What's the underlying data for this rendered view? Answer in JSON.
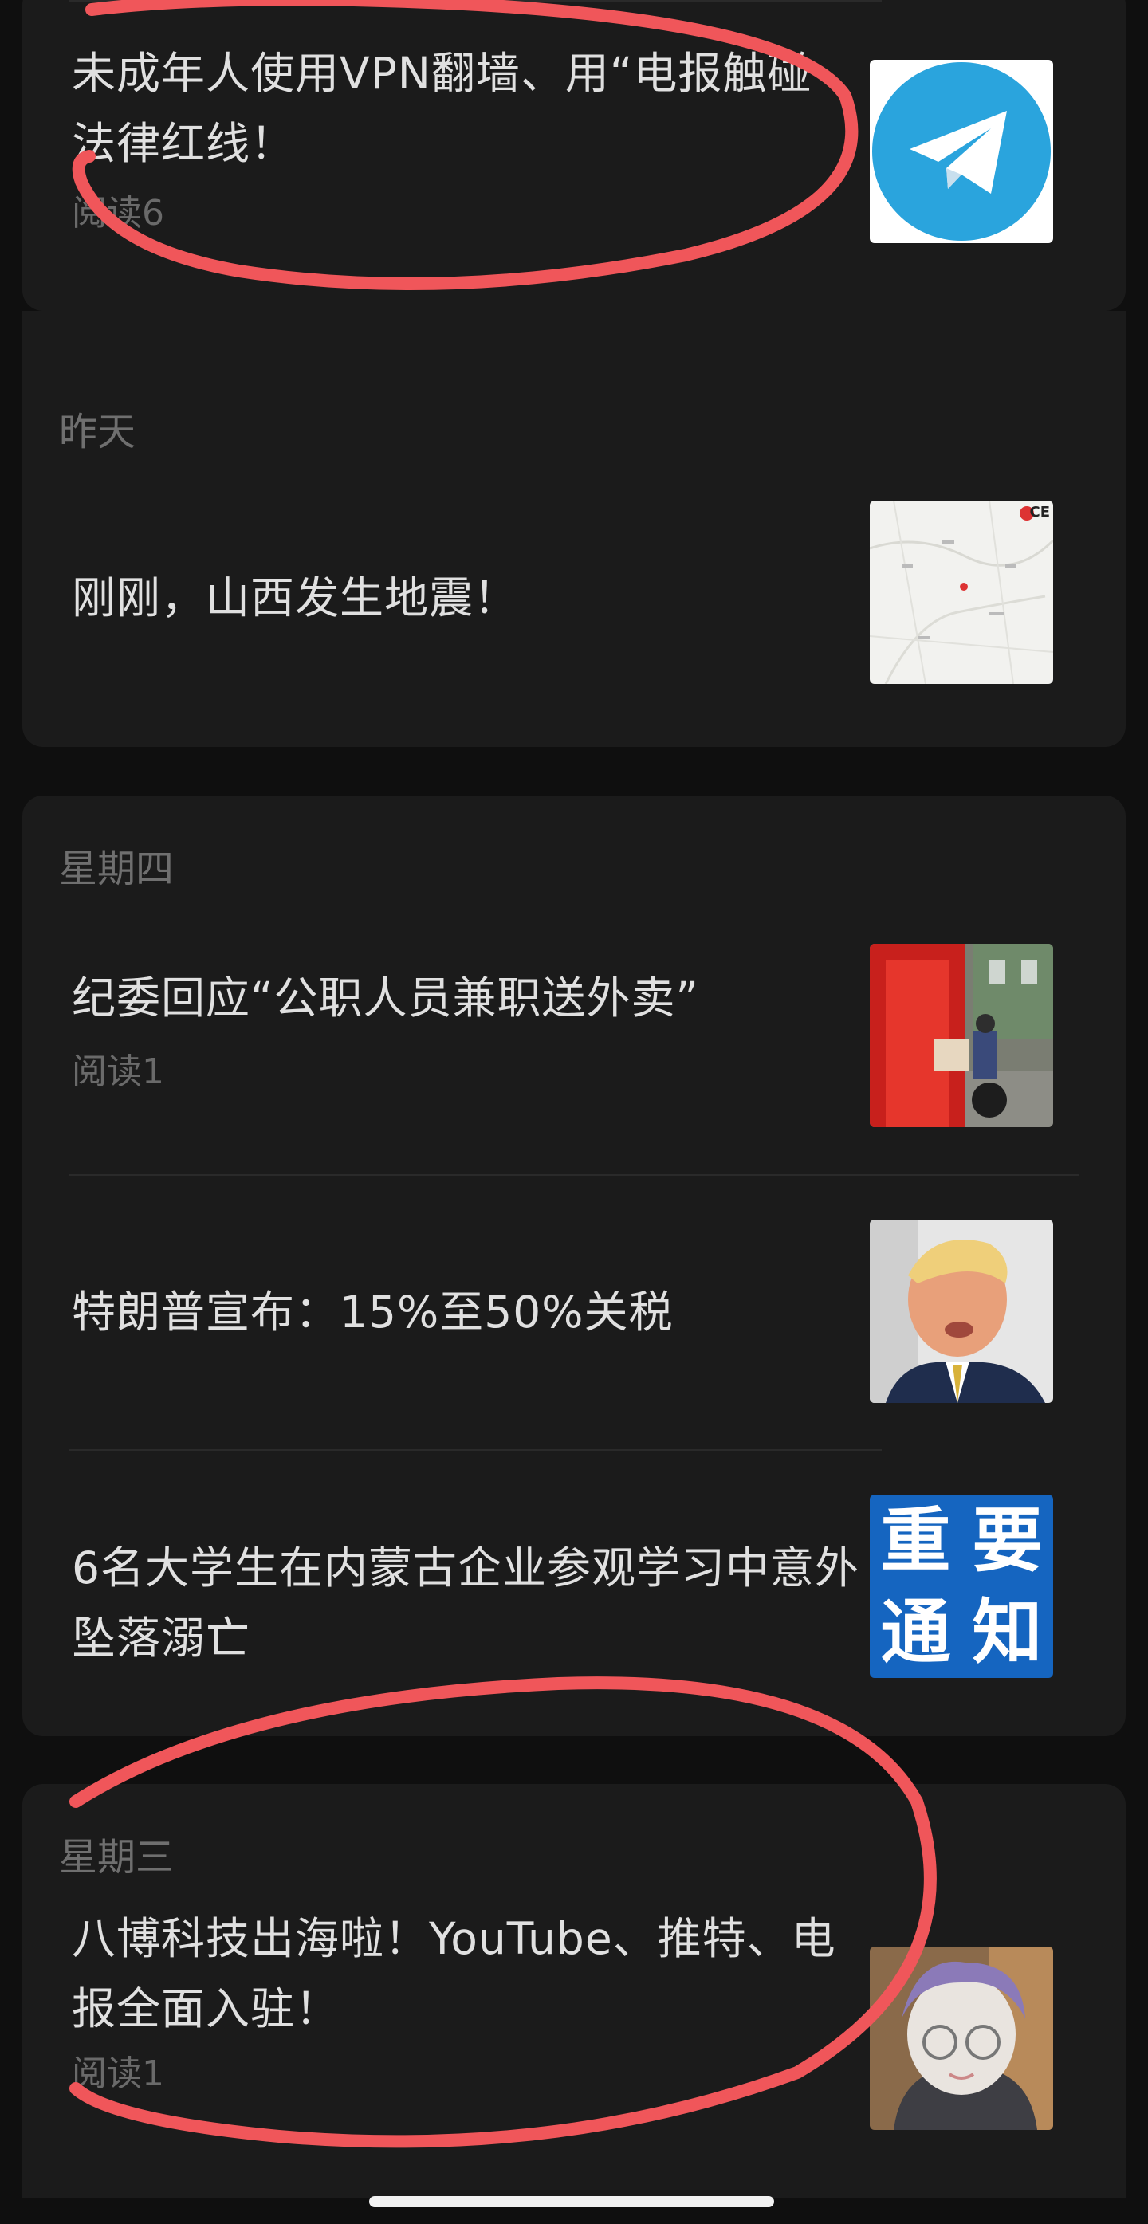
{
  "groups": [
    {
      "date": "",
      "articles": [
        {
          "title": "未成年人使用VPN翻墙、用“电报触碰法律红线！",
          "reads": "阅读6",
          "thumb_icon": "telegram-logo-icon"
        }
      ]
    },
    {
      "date": "昨天",
      "articles": [
        {
          "title": "刚刚，山西发生地震！",
          "reads": "",
          "thumb_icon": "earthquake-map-image"
        }
      ]
    },
    {
      "date": "星期四",
      "articles": [
        {
          "title": "纪委回应“公职人员兼职送外卖”",
          "reads": "阅读1",
          "thumb_icon": "delivery-rider-photo"
        },
        {
          "title": "特朗普宣布：15%至50%关税",
          "reads": "",
          "thumb_icon": "trump-photo"
        },
        {
          "title": "6名大学生在内蒙古企业参观学习中意外坠落溺亡",
          "reads": "",
          "thumb_icon": "important-notice-image"
        }
      ]
    },
    {
      "date": "星期三",
      "articles": [
        {
          "title": "八博科技出海啦！YouTube、推特、电报全面入驻！",
          "reads": "阅读1",
          "thumb_icon": "avatar-cartoon-image"
        }
      ]
    }
  ],
  "notice_image_text": [
    "重",
    "要",
    "通",
    "知"
  ],
  "map_badge_text": "CE",
  "colors": {
    "annotation_ink": "#f0565a",
    "notice_blue": "#1565c0",
    "telegram_blue": "#2aa4dd"
  }
}
